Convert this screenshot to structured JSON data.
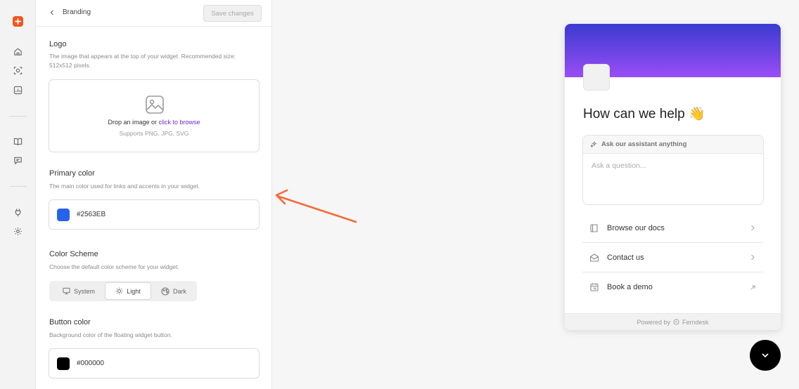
{
  "colors": {
    "accent": "#f4541d",
    "primary": "#2563EB",
    "button": "#000000",
    "link": "#6b2bd9"
  },
  "rail": {
    "icons": [
      "brand-logo-icon",
      "home-icon",
      "scan-face-icon",
      "chart-icon",
      "book-icon",
      "message-icon",
      "plug-icon",
      "gear-icon"
    ]
  },
  "panel": {
    "title": "Branding",
    "save_label": "Save changes"
  },
  "logo": {
    "title": "Logo",
    "description": "The image that appears at the top of your widget. Recommended size: 512x512 pixels.",
    "drop_text": "Drop an image or ",
    "drop_link": "click to browse",
    "formats": "Supports PNG, JPG, SVG"
  },
  "primary_color": {
    "title": "Primary color",
    "description": "The main color used for links and accents in your widget.",
    "value": "#2563EB"
  },
  "color_scheme": {
    "title": "Color Scheme",
    "description": "Choose the default color scheme for your widget.",
    "options": [
      "System",
      "Light",
      "Dark"
    ],
    "selected": "Light"
  },
  "button_color": {
    "title": "Button color",
    "description": "Background color of the floating widget button.",
    "value": "#000000"
  },
  "widget": {
    "title": "How can we help 👋",
    "ask_header": "Ask our assistant anything",
    "ask_placeholder": "Ask a question...",
    "links": [
      {
        "label": "Browse our docs",
        "icon": "book-icon",
        "action": "chevron-right-icon"
      },
      {
        "label": "Contact us",
        "icon": "mail-icon",
        "action": "chevron-right-icon"
      },
      {
        "label": "Book a demo",
        "icon": "calendar-icon",
        "action": "arrow-up-right-icon"
      }
    ],
    "footer_prefix": "Powered by",
    "footer_brand": "Ferndesk"
  }
}
